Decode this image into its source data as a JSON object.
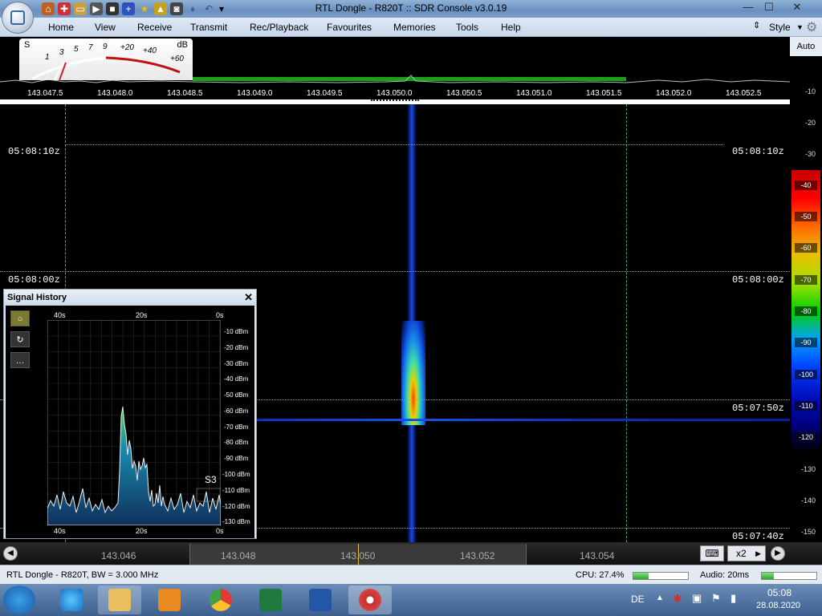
{
  "window": {
    "title": "RTL Dongle - R820T :: SDR Console v3.0.19",
    "min": "—",
    "max": "☐",
    "close": "✕"
  },
  "menu": {
    "items": [
      "Home",
      "View",
      "Receive",
      "Transmit",
      "Rec/Playback",
      "Favourites",
      "Memories",
      "Tools",
      "Help"
    ],
    "style_label": "Style"
  },
  "smeter": {
    "s_label": "S",
    "db_label": "dB",
    "ticks": [
      "1",
      "3",
      "5",
      "7",
      "9",
      "+20",
      "+40",
      "+60"
    ]
  },
  "freq_scale": [
    "143.047.5",
    "143.048.0",
    "143.048.5",
    "143.049.0",
    "143.049.5",
    "143.050.0",
    "143.050.5",
    "143.051.0",
    "143.051.5",
    "143.052.0",
    "143.052.5"
  ],
  "right_scale": {
    "auto_label": "Auto",
    "top_ticks": [
      "-10",
      "-20",
      "-30"
    ],
    "bottom_ticks": [
      "-130",
      "-140",
      "-150"
    ],
    "color_labels": [
      "-40",
      "-50",
      "-60",
      "-70",
      "-80",
      "-90",
      "-100",
      "-110",
      "-120"
    ]
  },
  "time_labels": [
    {
      "text": "05:08:10z"
    },
    {
      "text": "05:08:00z"
    },
    {
      "text": "05:07:50z"
    },
    {
      "text": "05:07:40z"
    }
  ],
  "signal_history": {
    "title": "Signal History",
    "close": "✕",
    "top_axis": [
      "40s",
      "20s",
      "0s"
    ],
    "bottom_axis": [
      "40s",
      "20s",
      "0s"
    ],
    "dbm_labels": [
      "-10 dBm",
      "-20 dBm",
      "-30 dBm",
      "-40 dBm",
      "-50 dBm",
      "-60 dBm",
      "-70 dBm",
      "-80 dBm",
      "-90 dBm",
      "-100 dBm",
      "-110 dBm",
      "-120 dBm",
      "-130 dBm"
    ],
    "s_reading": "S3",
    "side_buttons": [
      "○",
      "↻",
      "…"
    ]
  },
  "tuner": {
    "freqs": [
      "143.046",
      "143.048",
      "143.050",
      "143.052",
      "143.054"
    ],
    "zoom": "x2"
  },
  "status": {
    "device": "RTL Dongle - R820T, BW = 3.000 MHz",
    "cpu": "CPU: 27.4%",
    "audio": "Audio: 20ms",
    "cpu_fraction": 0.274
  },
  "taskbar": {
    "lang": "DE",
    "time": "05:08",
    "date": "28.08.2020"
  }
}
